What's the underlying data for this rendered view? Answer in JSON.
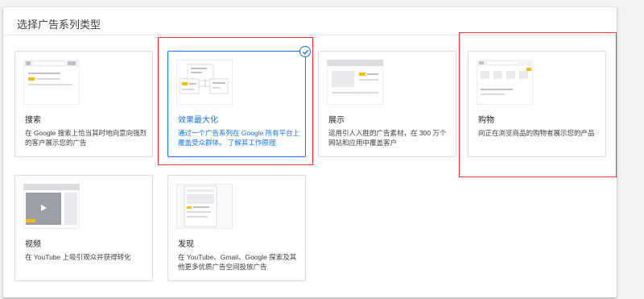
{
  "panel": {
    "title": "选择广告系列类型"
  },
  "cards": {
    "search": {
      "name": "搜索",
      "desc": "在 Google 搜索上恰当其时地向意向强烈的客户展示您的广告"
    },
    "pmax": {
      "name": "效果最大化",
      "desc": "通过一个广告系列在 Google 所有平台上覆盖受众群体。",
      "link": "了解其工作原理"
    },
    "display": {
      "name": "展示",
      "desc": "运用引人入胜的广告素材，在 300 万个网站和应用中覆盖客户"
    },
    "shopping": {
      "name": "购物",
      "desc": "向正在浏览商品的购物者展示您的产品"
    },
    "video": {
      "name": "视频",
      "desc": "在 YouTube 上吸引观众并获得转化"
    },
    "discovery": {
      "name": "发现",
      "desc": "在 YouTube、Gmail、Google 探索及其他更多优质广告空间投放广告"
    }
  },
  "colors": {
    "accent": "#1a73e8",
    "highlight": "#e53935",
    "thumb_yellow": "#fbbc04"
  },
  "icons": {
    "selected": "check-circle-icon"
  }
}
